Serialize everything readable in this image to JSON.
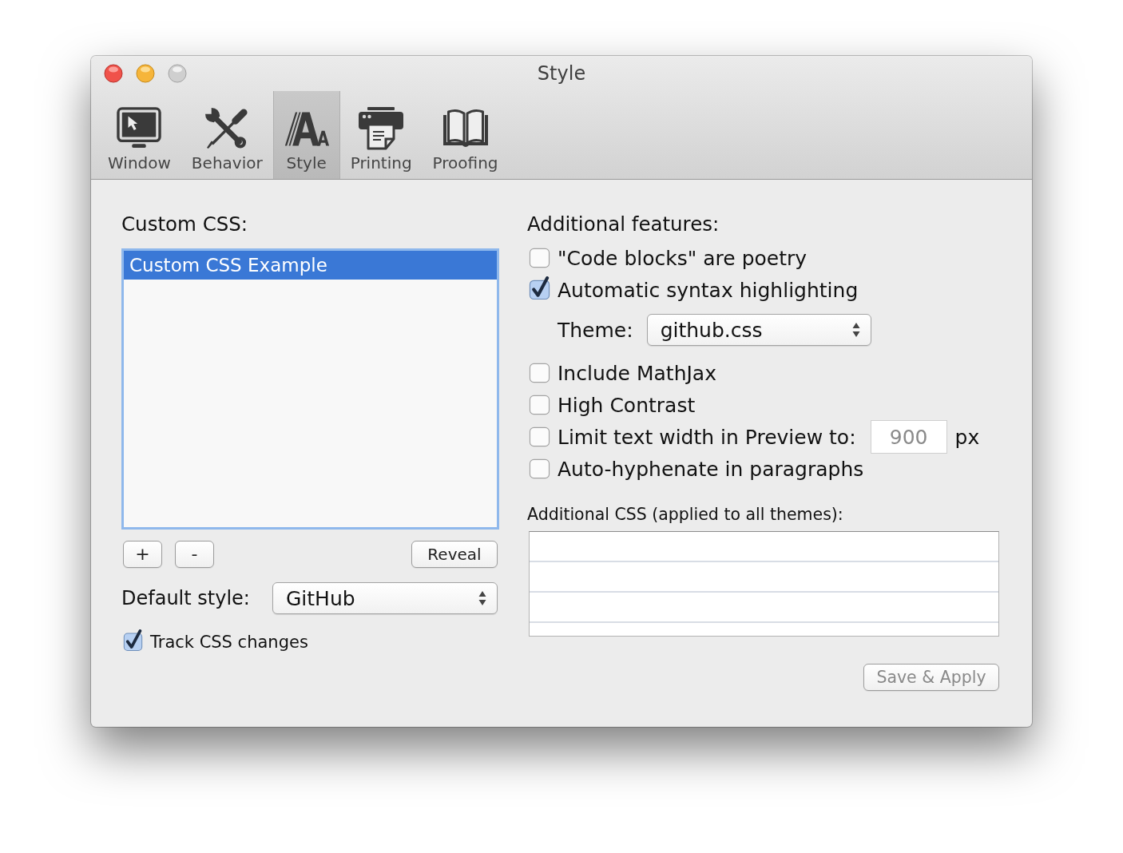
{
  "window": {
    "title": "Style",
    "zoom_enabled": false
  },
  "toolbar": [
    {
      "kind": "window",
      "label": "Window",
      "selected": false
    },
    {
      "kind": "behavior",
      "label": "Behavior",
      "selected": false
    },
    {
      "kind": "style",
      "label": "Style",
      "selected": true
    },
    {
      "kind": "printing",
      "label": "Printing",
      "selected": false
    },
    {
      "kind": "proofing",
      "label": "Proofing",
      "selected": false
    }
  ],
  "custom_css": {
    "label": "Custom CSS:",
    "items": [
      {
        "label": "Custom CSS Example",
        "selected": true
      }
    ],
    "add_button": "+",
    "remove_button": "-",
    "reveal_button": "Reveal"
  },
  "default_style": {
    "label": "Default style:",
    "value": "GitHub"
  },
  "track_css_changes": {
    "label": "Track CSS changes",
    "checked": true
  },
  "features": {
    "label": "Additional features:",
    "items": [
      {
        "kind": "checkbox",
        "label": "\"Code blocks\" are poetry",
        "checked": false
      },
      {
        "kind": "checkbox",
        "label": "Automatic syntax highlighting",
        "checked": true
      },
      {
        "kind": "popup",
        "label": "Theme:",
        "value": "github.css"
      },
      {
        "kind": "checkbox",
        "label": "Include MathJax",
        "checked": false
      },
      {
        "kind": "checkbox",
        "label": "High Contrast",
        "checked": false
      },
      {
        "kind": "width",
        "label": "Limit text width in Preview to:",
        "checked": false,
        "placeholder": "900",
        "unit": "px"
      },
      {
        "kind": "checkbox",
        "label": "Auto-hyphenate in paragraphs",
        "checked": false
      }
    ]
  },
  "additional_css": {
    "label": "Additional CSS (applied to all themes):"
  },
  "save_button": {
    "label": "Save & Apply",
    "disabled": true
  }
}
